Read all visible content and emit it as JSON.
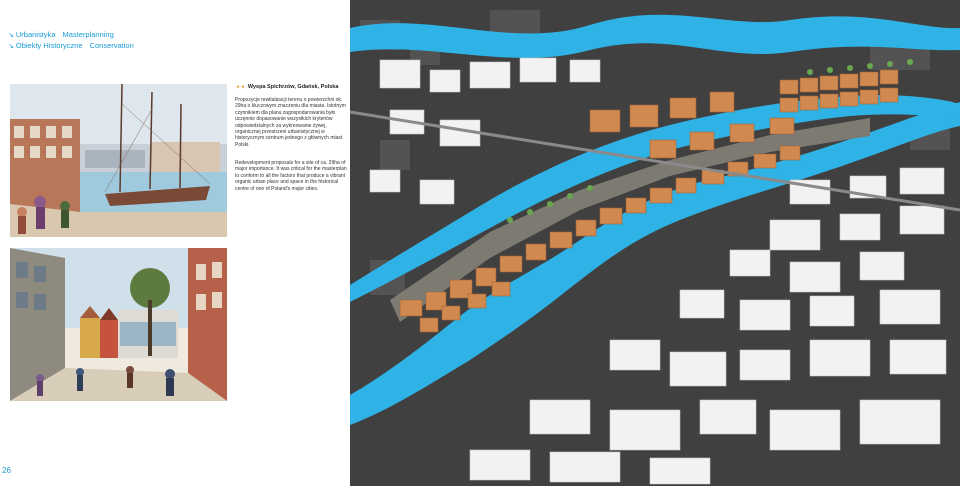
{
  "nav": {
    "row1": {
      "item1": "Urbanistyka",
      "item2": "Masterplanning"
    },
    "row2": {
      "item1": "Obiekty Historyczne",
      "item2": "Conservation"
    },
    "arrow": "↘"
  },
  "project": {
    "bullet": "◄◄",
    "title": "Wyspa Spichrzów, Gdańsk, Polska"
  },
  "description": {
    "polish": "Propozycje rewitalizacji terenu o powierzchni ok. 29ha o kluczowym znaczeniu dla miasta. Istotnym czynnikiem dla planu zagospodarowania było uczęnnie dopasowanie wszystkich kryteriów odpowiedzialnych za wykreowanie żywej, organicznej przestrzeni urbanistycznej w historycznym centrum jednego z głównych miast Polski.",
    "english": "Redevelopment proposals for a site of ca. 29ha of major importance. It was critical for the masterplan to conform to all the factors that produce a vibrant organic urban place and space in the historical centre of one of Poland's major cities."
  },
  "page_number": "26",
  "colors": {
    "accent": "#1a9ad6",
    "bullet": "#e9a33a",
    "water": "#2fb3e6",
    "new_buildings": "#d08a4f",
    "existing_buildings": "#f2f2f2",
    "ground": "#3a3a3a"
  }
}
